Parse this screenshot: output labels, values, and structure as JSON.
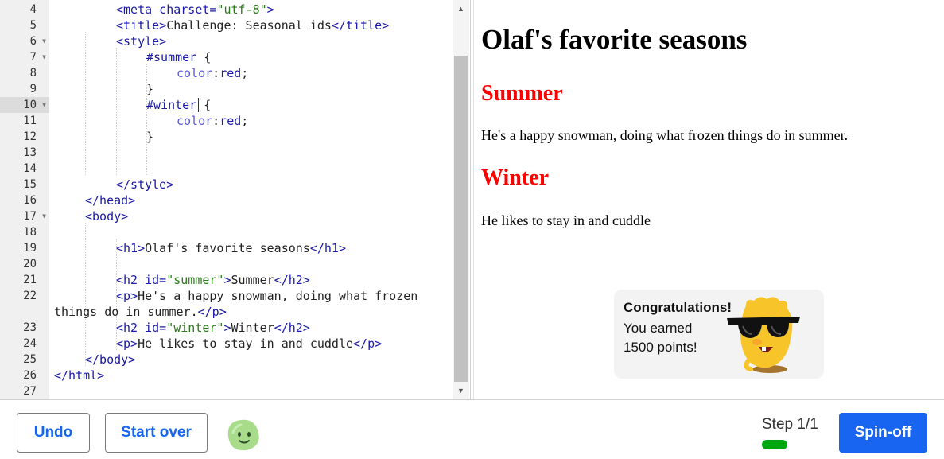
{
  "editor": {
    "line_numbers": [
      "4",
      "5",
      "6",
      "7",
      "8",
      "9",
      "10",
      "11",
      "12",
      "13",
      "14",
      "15",
      "16",
      "17",
      "18",
      "19",
      "20",
      "21",
      "22",
      "23",
      "24",
      "25",
      "26",
      "27"
    ],
    "fold_markers": [
      "6",
      "7",
      "10",
      "17"
    ],
    "active_line": "10",
    "code_lines": [
      [
        {
          "t": "<meta charset=",
          "c": "tag"
        },
        {
          "t": "\"utf-8\"",
          "c": "str"
        },
        {
          "t": ">",
          "c": "tag"
        }
      ],
      [
        {
          "t": "<title>",
          "c": "tag"
        },
        {
          "t": "Challenge: Seasonal ids",
          "c": "txt"
        },
        {
          "t": "</title>",
          "c": "tag"
        }
      ],
      [
        {
          "t": "<style>",
          "c": "tag"
        }
      ],
      [
        {
          "t": "#summer",
          "c": "sel"
        },
        {
          "t": " {",
          "c": "txt"
        }
      ],
      [
        {
          "t": "color",
          "c": "prop"
        },
        {
          "t": ":",
          "c": "txt"
        },
        {
          "t": "red",
          "c": "val"
        },
        {
          "t": ";",
          "c": "txt"
        }
      ],
      [
        {
          "t": "}",
          "c": "txt"
        }
      ],
      [
        {
          "t": "#winter",
          "c": "sel"
        },
        {
          "t": " {",
          "c": "txt"
        }
      ],
      [
        {
          "t": "color",
          "c": "prop"
        },
        {
          "t": ":",
          "c": "txt"
        },
        {
          "t": "red",
          "c": "val"
        },
        {
          "t": ";",
          "c": "txt"
        }
      ],
      [
        {
          "t": "}",
          "c": "txt"
        }
      ],
      [],
      [],
      [
        {
          "t": "</style>",
          "c": "tag"
        }
      ],
      [
        {
          "t": "</head>",
          "c": "tag"
        }
      ],
      [
        {
          "t": "<body>",
          "c": "tag"
        }
      ],
      [],
      [
        {
          "t": "<h1>",
          "c": "tag"
        },
        {
          "t": "Olaf's favorite seasons",
          "c": "txt"
        },
        {
          "t": "</h1>",
          "c": "tag"
        }
      ],
      [],
      [
        {
          "t": "<h2 id=",
          "c": "tag"
        },
        {
          "t": "\"summer\"",
          "c": "str"
        },
        {
          "t": ">",
          "c": "tag"
        },
        {
          "t": "Summer",
          "c": "txt"
        },
        {
          "t": "</h2>",
          "c": "tag"
        }
      ],
      [
        {
          "t": "<p>",
          "c": "tag"
        },
        {
          "t": "He's a happy snowman, doing what frozen",
          "c": "txt"
        }
      ],
      [
        {
          "t": "things do in summer.",
          "c": "txt"
        },
        {
          "t": "</p>",
          "c": "tag"
        }
      ],
      [
        {
          "t": "<h2 id=",
          "c": "tag"
        },
        {
          "t": "\"winter\"",
          "c": "str"
        },
        {
          "t": ">",
          "c": "tag"
        },
        {
          "t": "Winter",
          "c": "txt"
        },
        {
          "t": "</h2>",
          "c": "tag"
        }
      ],
      [
        {
          "t": "<p>",
          "c": "tag"
        },
        {
          "t": "He likes to stay in and cuddle",
          "c": "txt"
        },
        {
          "t": "</p>",
          "c": "tag"
        }
      ],
      [
        {
          "t": "</body>",
          "c": "tag"
        }
      ],
      [
        {
          "t": "</html>",
          "c": "tag"
        }
      ]
    ]
  },
  "preview": {
    "h1": "Olaf's favorite seasons",
    "summer_heading": "Summer",
    "summer_text": "He's a happy snowman, doing what frozen things do in summer.",
    "winter_heading": "Winter",
    "winter_text": "He likes to stay in and cuddle",
    "congrats": {
      "title": "Congratulations!",
      "line1": "You earned",
      "line2": "1500 points!",
      "mascot_icon": "sunglasses-mascot-icon"
    },
    "heading_color": "#ff0000"
  },
  "footer": {
    "undo_label": "Undo",
    "start_over_label": "Start over",
    "avatar_icon": "green-blob-avatar-icon",
    "step_text": "Step 1/1",
    "step_progress": 1.0,
    "step_bar_color": "#00a60e",
    "spin_off_label": "Spin-off",
    "accent_color": "#1865f2"
  }
}
